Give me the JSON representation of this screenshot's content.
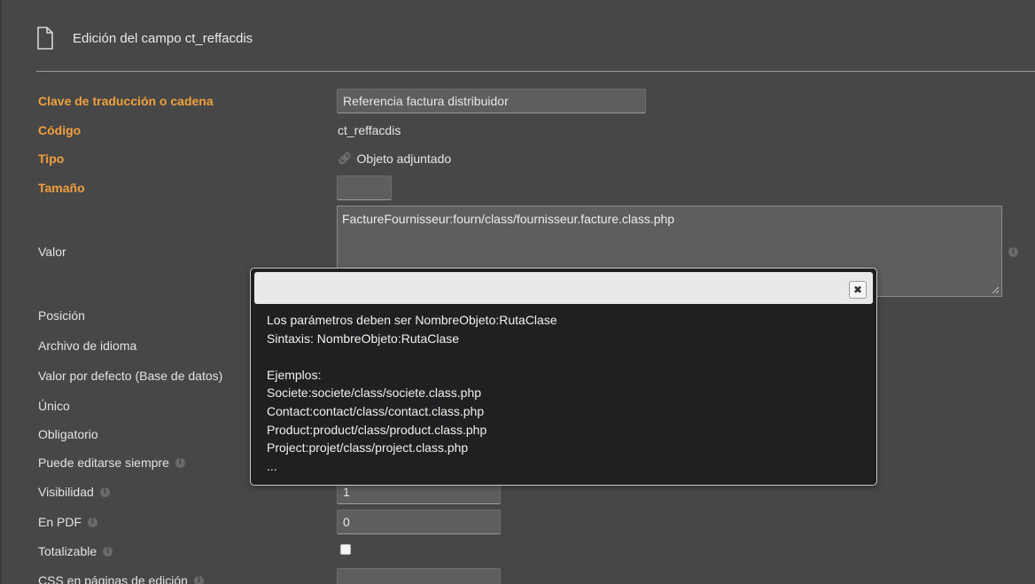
{
  "page": {
    "title": "Edición del campo ct_reffacdis"
  },
  "icons": {
    "document": "document-icon",
    "link": "link-icon",
    "info": "info-icon",
    "close": "close-icon"
  },
  "colors": {
    "background": "#474747",
    "required_label": "#f0a13e",
    "dialog_bg": "#1f2021"
  },
  "fields": {
    "clave": {
      "label": "Clave de traducción o cadena",
      "value": "Referencia factura distribuidor"
    },
    "codigo": {
      "label": "Código",
      "value": "ct_reffacdis"
    },
    "tipo": {
      "label": "Tipo",
      "value": "Objeto adjuntado"
    },
    "tamano": {
      "label": "Tamaño",
      "value": ""
    },
    "valor": {
      "label": "Valor",
      "value": "FactureFournisseur:fourn/class/fournisseur.facture.class.php"
    },
    "posicion": {
      "label": "Posición"
    },
    "archivo_idioma": {
      "label": "Archivo de idioma"
    },
    "valor_defecto": {
      "label": "Valor por defecto (Base de datos)"
    },
    "unico": {
      "label": "Único"
    },
    "obligatorio": {
      "label": "Obligatorio"
    },
    "editable": {
      "label": "Puede editarse siempre"
    },
    "visibilidad": {
      "label": "Visibilidad",
      "value": "1"
    },
    "en_pdf": {
      "label": "En PDF",
      "value": "0"
    },
    "totalizable": {
      "label": "Totalizable",
      "checked": false
    },
    "css": {
      "label": "CSS en páginas de edición"
    }
  },
  "dialog": {
    "close_label": "✖",
    "lines": [
      "Los parámetros deben ser NombreObjeto:RutaClase",
      "Sintaxis: NombreObjeto:RutaClase",
      "",
      "Ejemplos:",
      "Societe:societe/class/societe.class.php",
      "Contact:contact/class/contact.class.php",
      "Product:product/class/product.class.php",
      "Project:projet/class/project.class.php",
      "..."
    ]
  }
}
